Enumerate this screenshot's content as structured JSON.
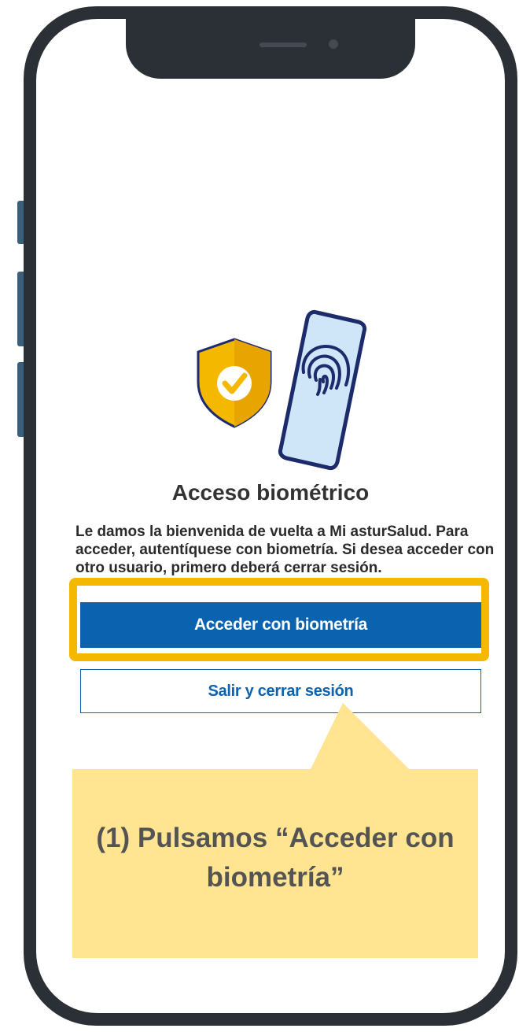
{
  "screen": {
    "title": "Acceso biométrico",
    "description": "Le damos la bienvenida de vuelta a Mi asturSalud. Para acceder, autentíquese con biometría. Si desea acceder con otro usuario, primero deberá cerrar sesión.",
    "primary_button": "Acceder con biometría",
    "secondary_button": "Salir y cerrar sesión",
    "hero_icons": [
      "shield-check-icon",
      "phone-fingerprint-icon"
    ]
  },
  "annotation": {
    "text": "(1) Pulsamos “Acceder con biometría”",
    "highlight_target": "primary_button"
  },
  "colors": {
    "primary": "#0b63b0",
    "highlight": "#f5b800",
    "callout": "#ffe591",
    "shield": "#f5b800",
    "phone_screen": "#cfe6f8",
    "phone_outline": "#1d2a6b",
    "frame": "#2b2f36"
  }
}
